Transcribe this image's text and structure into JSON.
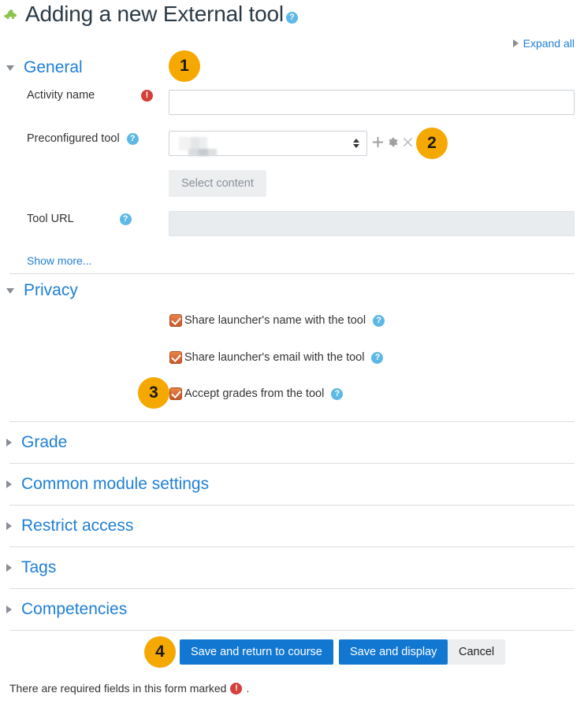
{
  "header": {
    "title": "Adding a new External tool",
    "icon": "puzzle-piece-icon",
    "help_icon": "?",
    "expand_all": "Expand all"
  },
  "sections": {
    "general": {
      "title": "General",
      "expanded": true,
      "activity_name": {
        "label": "Activity name",
        "value": "",
        "required": true
      },
      "preconfigured_tool": {
        "label": "Preconfigured tool",
        "value": "",
        "value_redacted": true,
        "icons": [
          "plus-icon",
          "gear-icon",
          "close-icon"
        ]
      },
      "select_content_button": "Select content",
      "tool_url": {
        "label": "Tool URL",
        "value": "",
        "disabled": true
      },
      "show_more": "Show more..."
    },
    "privacy": {
      "title": "Privacy",
      "expanded": true,
      "checkboxes": [
        {
          "label": "Share launcher's name with the tool",
          "checked": true
        },
        {
          "label": "Share launcher's email with the tool",
          "checked": true
        },
        {
          "label": "Accept grades from the tool",
          "checked": true
        }
      ]
    },
    "collapsed": [
      {
        "title": "Grade"
      },
      {
        "title": "Common module settings"
      },
      {
        "title": "Restrict access"
      },
      {
        "title": "Tags"
      },
      {
        "title": "Competencies"
      }
    ]
  },
  "badges": [
    {
      "number": "1"
    },
    {
      "number": "2"
    },
    {
      "number": "3"
    },
    {
      "number": "4"
    }
  ],
  "footer": {
    "save_return_label": "Save and return to course",
    "save_display_label": "Save and display",
    "cancel_label": "Cancel",
    "required_note_before": "There are required fields in this form marked",
    "required_note_after": "."
  },
  "colors": {
    "link": "#1f7fd4",
    "primary_button": "#1177d1",
    "badge": "#f5a800",
    "checkbox": "#c95a2a",
    "required": "#d43f3a",
    "help": "#5cb8e6"
  }
}
